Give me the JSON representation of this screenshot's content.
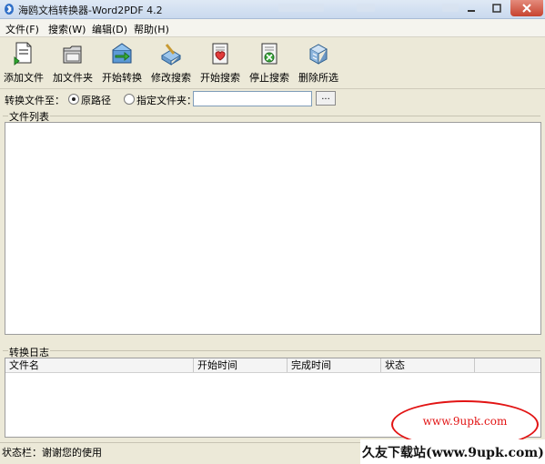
{
  "window": {
    "title": "海鸥文档转换器-Word2PDF 4.2"
  },
  "menu": [
    "文件(F)",
    "搜索(W)",
    "编辑(D)",
    "帮助(H)"
  ],
  "toolbar": [
    {
      "label": "添加文件",
      "icon": "add-file-icon"
    },
    {
      "label": "加文件夹",
      "icon": "add-folder-icon"
    },
    {
      "label": "开始转换",
      "icon": "start-convert-icon"
    },
    {
      "label": "修改搜索",
      "icon": "modify-search-icon"
    },
    {
      "label": "开始搜索",
      "icon": "start-search-icon"
    },
    {
      "label": "停止搜索",
      "icon": "stop-search-icon"
    },
    {
      "label": "删除所选",
      "icon": "delete-selected-icon"
    }
  ],
  "convert_to": {
    "label": "转换文件至：",
    "option_original": "原路径",
    "option_custom": "指定文件夹：",
    "selected": "original",
    "path_value": "",
    "browse_label": "..."
  },
  "file_list": {
    "title": "文件列表"
  },
  "log": {
    "title": "转换日志",
    "columns": [
      "文件名",
      "开始时间",
      "完成时间",
      "状态"
    ]
  },
  "status_bar": {
    "text": "状态栏：谢谢您的使用"
  },
  "watermark": {
    "oval_text": "www.9upk.com",
    "banner_text": "久友下载站(www.9upk.com)"
  },
  "colors": {
    "watermark": "#e21414",
    "close_button": "#c7432f"
  }
}
